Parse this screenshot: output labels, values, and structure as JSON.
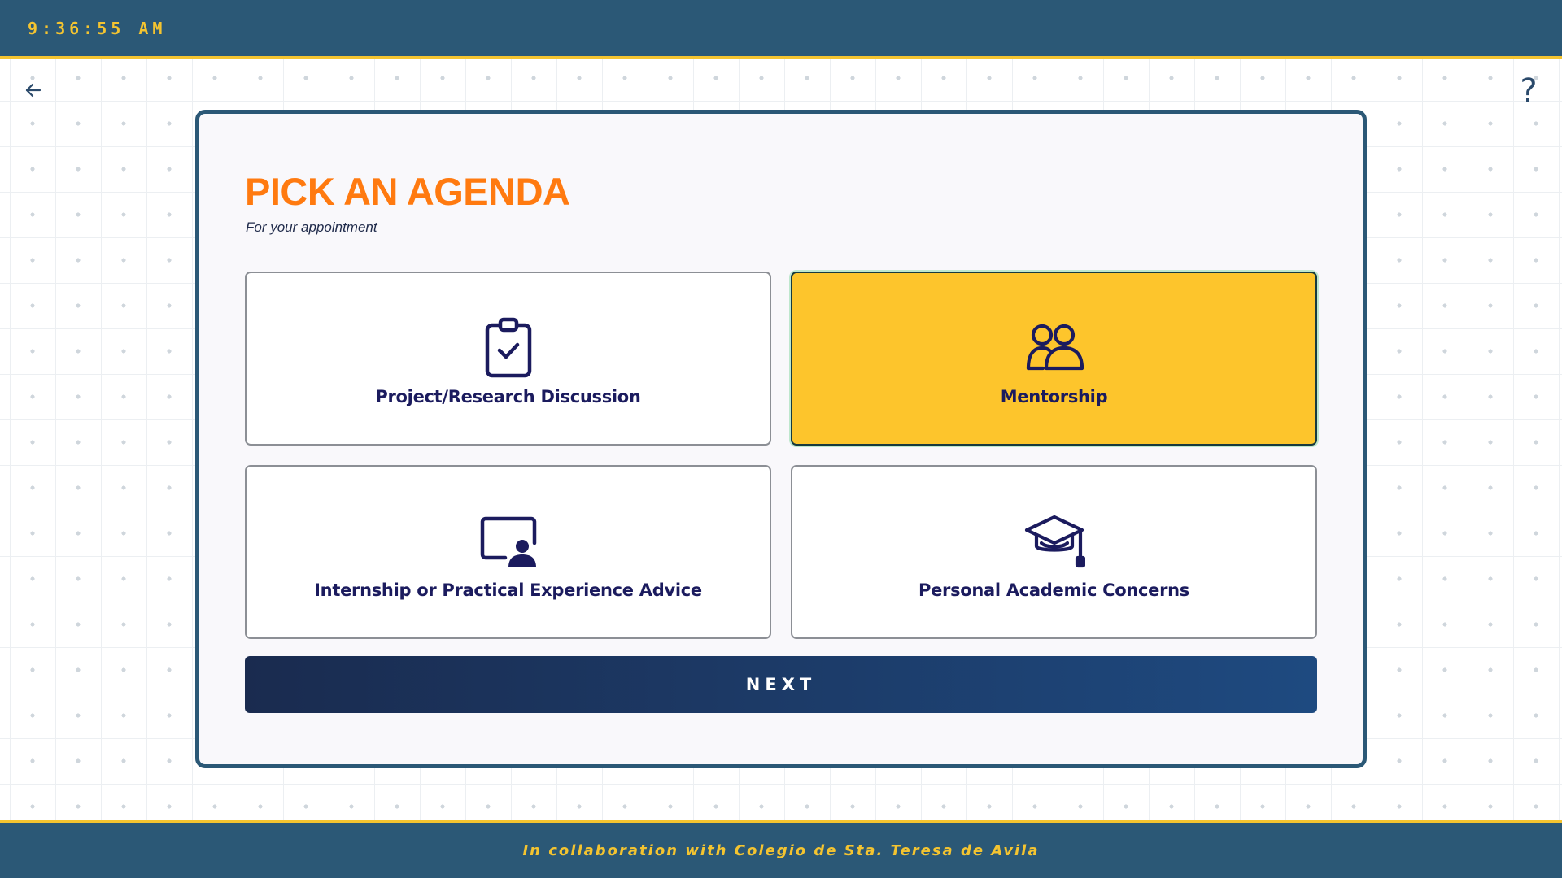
{
  "header": {
    "clock": "9:36:55 AM"
  },
  "nav": {
    "back_icon": "arrow-left-icon",
    "help_label": "?"
  },
  "main": {
    "title": "PICK AN AGENDA",
    "subtitle": "For your appointment",
    "options": [
      {
        "label": "Project/Research Discussion",
        "icon": "clipboard-check-icon",
        "selected": false
      },
      {
        "label": "Mentorship",
        "icon": "users-icon",
        "selected": true
      },
      {
        "label": "Internship or Practical Experience Advice",
        "icon": "presentation-user-icon",
        "selected": false
      },
      {
        "label": "Personal Academic Concerns",
        "icon": "graduation-cap-icon",
        "selected": false
      }
    ],
    "next_label": "NEXT"
  },
  "footer": {
    "text": "In collaboration with Colegio de Sta. Teresa de Avila"
  },
  "colors": {
    "header_bg": "#2b5876",
    "accent_yellow": "#f4c430",
    "title_orange": "#ff7a10",
    "selected_bg": "#fdc52c",
    "icon_navy": "#1b1b5e"
  }
}
